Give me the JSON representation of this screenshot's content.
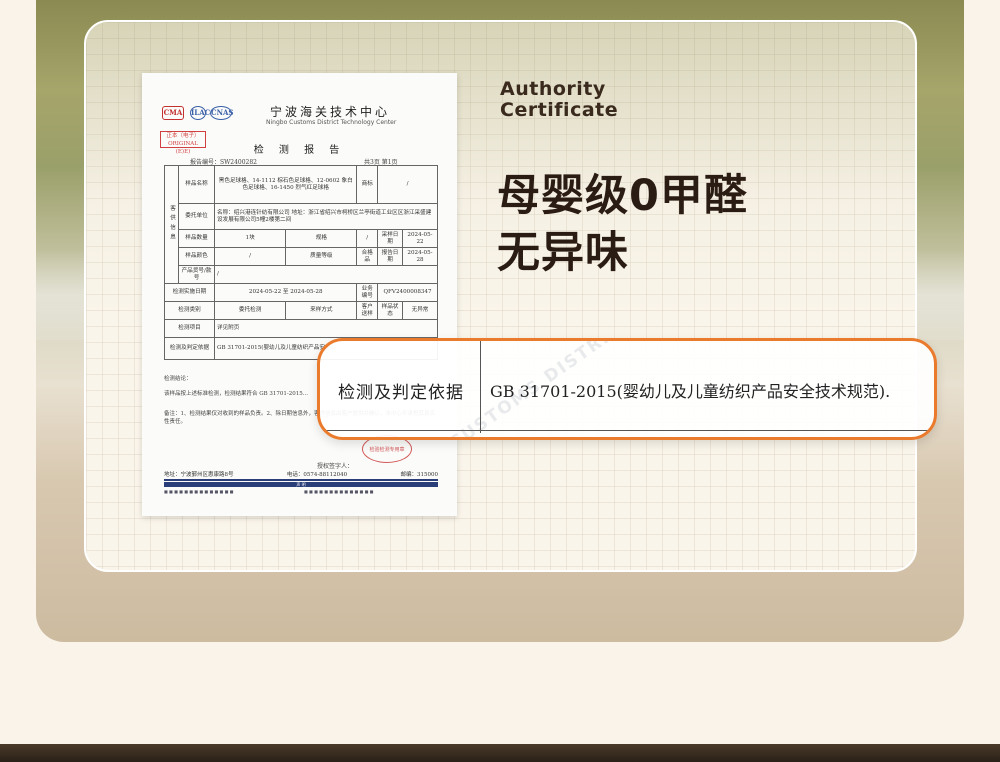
{
  "section": {
    "title_line1": "Authority",
    "title_line2": "Certificate",
    "headline_line1": "母婴级0甲醛",
    "headline_line2": "无异味"
  },
  "certificate": {
    "logos": [
      "CMA",
      "ILAC",
      "CNAS"
    ],
    "org_name": "宁波海关技术中心",
    "org_name_en": "Ningbo Customs District Technology Center",
    "original_stamp": "正本（电子） ORIGINAL (E)E)",
    "title": "检 测 报 告",
    "report_no": "报告编号：SW2400282",
    "page_info": "共3页  第1页",
    "rows": [
      {
        "label": "样品名称",
        "value": "黑色足球格、14-1112 棕石色足球格、12-0602 象白色足球格、16-1450 烈气红足球格",
        "label2": "商标",
        "value2": "/"
      },
      {
        "label": "委托单位",
        "value": "名称：绍兴港连针纺有限公司 地址：浙江省绍兴市柯桥区兰亭街道工业区区浙江采盛建设发展有限公司5幢2楼第二间"
      },
      {
        "label": "样品数量",
        "value": "1块",
        "label2": "规格",
        "value2": "/",
        "label3": "采样日期",
        "value3": "2024-05-22"
      },
      {
        "label": "样品颜色",
        "value": "/",
        "label2": "质量等级",
        "value2": "合格品",
        "label3": "报告日期",
        "value3": "2024-05-28"
      },
      {
        "label": "产品货号/款号",
        "value": "/"
      }
    ],
    "side_label": "客供信息",
    "rows2": [
      {
        "label": "检测实施日期",
        "value": "2024-05-22 至 2024-05-28",
        "label2": "业务编号",
        "value2": "QFV2400008347"
      },
      {
        "label": "检测类别",
        "value": "委托检测",
        "label2": "来样方式",
        "value2": "客户送样",
        "label3": "样品状态",
        "value3": "无异常"
      },
      {
        "label": "检测项目",
        "value": "详见附页"
      },
      {
        "label": "检测及判定依据",
        "value": "GB 31701-2015(婴幼儿及儿童纺织产品安全..."
      }
    ],
    "conclusion_label": "检测结论：",
    "conclusion": "该样品按上述标准检测，检测结果符合 GB 31701-2015...",
    "remarks": "备注：1、检测结果仅对收到的样品负责。2、除日期信息外，客供信息由客户提供并确认，本中心不承担其真实性责任。",
    "signer": "授权签字人：",
    "seal_text": "检验检测专用章",
    "address": "地址：宁波鄞州区惠康路8号",
    "phone": "电话：0574-88112040",
    "postcode": "邮编：315000",
    "band_text": "声 明"
  },
  "callout": {
    "label": "检测及判定依据",
    "value": "GB 31701-2015(婴幼儿及儿童纺织产品安全技术规范).",
    "watermark": "NINGBO CUSTOMS DISTRICT TECHNOLOGY CENTER"
  },
  "colors": {
    "accent_orange": "#ea7a2c",
    "headline": "#2a1c12",
    "card_bg": "#faf5ea"
  }
}
